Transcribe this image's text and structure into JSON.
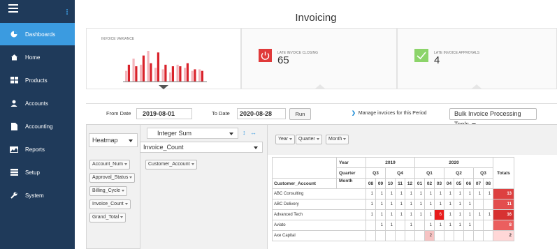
{
  "sidebar": {
    "items": [
      {
        "label": "Dashboards",
        "icon": "dashboard-icon",
        "active": true
      },
      {
        "label": "Home",
        "icon": "home-icon"
      },
      {
        "label": "Products",
        "icon": "products-icon"
      },
      {
        "label": "Accounts",
        "icon": "user-icon"
      },
      {
        "label": "Accounting",
        "icon": "document-icon"
      },
      {
        "label": "Reports",
        "icon": "chart-icon"
      },
      {
        "label": "Setup",
        "icon": "setup-icon"
      },
      {
        "label": "System",
        "icon": "wrench-icon"
      }
    ]
  },
  "page": {
    "title": "Invoicing"
  },
  "cards": {
    "variance": {
      "label": "INVOICE VARIANCE"
    },
    "late_closing": {
      "label": "LATE INVOICE CLOSING",
      "value": "65"
    },
    "late_approvals": {
      "label": "LATE INVOICE APPROVALS",
      "value": "4"
    }
  },
  "variance_bars": [
    {
      "pink": 0.35,
      "red": 0.55
    },
    {
      "pink": 0.75,
      "red": 0.5
    },
    {
      "pink": 0.55,
      "red": 0.85
    },
    {
      "pink": 1.0,
      "red": 0.6
    },
    {
      "pink": 0.45,
      "red": 0.95
    },
    {
      "pink": 0.4,
      "red": 0.55
    },
    {
      "pink": 0.3,
      "red": 0.5
    },
    {
      "pink": 0.55,
      "red": 0.5
    },
    {
      "pink": 0.45,
      "red": 0.6
    },
    {
      "pink": 0.35,
      "red": 0.4
    },
    {
      "pink": 0.4,
      "red": 0.35
    }
  ],
  "toolbar": {
    "from_label": "From Date",
    "from_value": "2019-08-01",
    "to_label": "To Date",
    "to_value": "2020-08-28",
    "run_label": "Run",
    "manage_link": "Manage invoices for this Period",
    "bulk_label": "Bulk Invoice Processing Tools"
  },
  "pivot": {
    "renderer": "Heatmap",
    "aggregator": "Integer Sum",
    "value_field": "Invoice_Count",
    "unused_attrs": [
      "Account_Num",
      "Approval_Status",
      "Billing_Cycle",
      "Invoice_Count",
      "Grand_Total"
    ],
    "row_attrs": [
      "Customer_Account"
    ],
    "col_attrs": [
      "Year",
      "Quarter",
      "Month"
    ],
    "header_labels": {
      "year": "Year",
      "quarter": "Quarter",
      "month": "Month",
      "row": "Customer_Account",
      "totals": "Totals"
    },
    "years": [
      {
        "label": "2019",
        "span": 5
      },
      {
        "label": "2020",
        "span": 8
      }
    ],
    "quarters": [
      {
        "label": "Q3",
        "span": 2
      },
      {
        "label": "Q4",
        "span": 3
      },
      {
        "label": "Q1",
        "span": 3
      },
      {
        "label": "Q2",
        "span": 3
      },
      {
        "label": "Q3",
        "span": 2
      }
    ],
    "months": [
      "08",
      "09",
      "10",
      "11",
      "12",
      "01",
      "02",
      "03",
      "04",
      "05",
      "06",
      "07",
      "08"
    ],
    "rows": [
      {
        "name": "ABC Consulting",
        "cells": [
          "1",
          "1",
          "1",
          "1",
          "1",
          "1",
          "1",
          "1",
          "1",
          "1",
          "1",
          "1",
          "1"
        ],
        "total": "13",
        "total_level": 0.85
      },
      {
        "name": "ABC Delivery",
        "cells": [
          "1",
          "1",
          "1",
          "1",
          "1",
          "1",
          "1",
          "1",
          "1",
          "1",
          "1",
          "",
          ""
        ],
        "total": "11",
        "total_level": 0.7
      },
      {
        "name": "Advanced Tech",
        "cells": [
          "1",
          "1",
          "1",
          "1",
          "1",
          "1",
          "1",
          "6",
          "1",
          "1",
          "1",
          "1",
          "1"
        ],
        "total": "16",
        "total_level": 1.0,
        "hot_index": 7
      },
      {
        "name": "Aviato",
        "cells": [
          "",
          "1",
          "1",
          "",
          "1",
          "",
          "1",
          "1",
          "1",
          "1",
          "1",
          "",
          ""
        ],
        "total": "8",
        "total_level": 0.5
      },
      {
        "name": "Axe Capital",
        "cells": [
          "",
          "",
          "",
          "",
          "",
          "",
          "2",
          "",
          "",
          "",
          "",
          "",
          ""
        ],
        "total": "2",
        "total_level": 0.1,
        "warm_index": 6
      }
    ]
  },
  "colors": {
    "sidebar": "#1f3a5a",
    "accent": "#3b9be0",
    "red": "#e03a3a",
    "green": "#8cd46a",
    "pink": "#f4b6bd",
    "bar_red": "#d9222b"
  }
}
